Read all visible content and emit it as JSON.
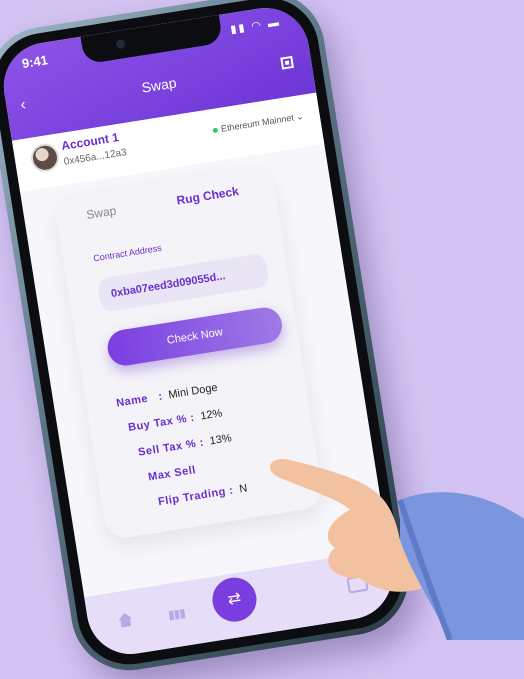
{
  "status": {
    "time": "9:41"
  },
  "header": {
    "title": "Swap"
  },
  "account": {
    "name": "Account 1",
    "address": "0x456a...12a3",
    "network": "Ethereum Mainnet"
  },
  "tabs": [
    {
      "label": "Swap"
    },
    {
      "label": "Rug Check"
    }
  ],
  "contract": {
    "label": "Contract Address",
    "value": "0xba07eed3d09055d..."
  },
  "actions": {
    "check_label": "Check Now"
  },
  "details": [
    {
      "key": "Name",
      "value": "Mini Doge"
    },
    {
      "key": "Buy Tax %",
      "value": "12%"
    },
    {
      "key": "Sell Tax %",
      "value": "13%"
    },
    {
      "key": "Max Sell",
      "value": ""
    },
    {
      "key": "Flip Trading",
      "value": "N"
    }
  ],
  "colors": {
    "accent": "#6a2ed1",
    "background": "#d3c3f2"
  },
  "icons": [
    "back-icon",
    "qr-icon",
    "home-icon",
    "chart-icon",
    "swap-icon",
    "wallet-icon"
  ]
}
